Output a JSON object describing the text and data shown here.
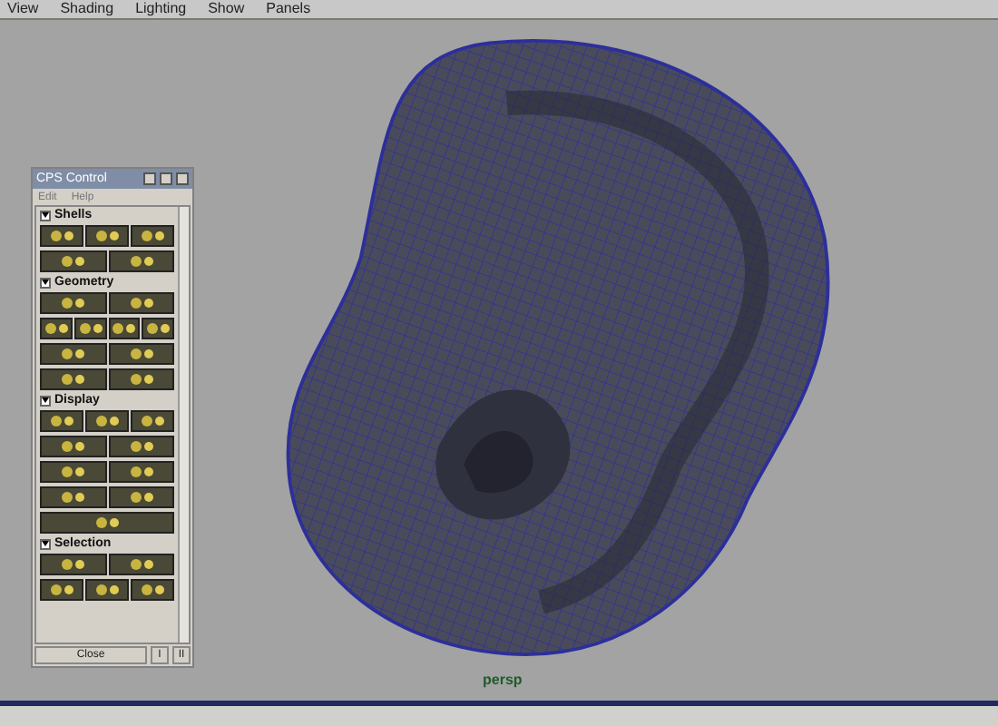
{
  "menu_bar": {
    "items": [
      "View",
      "Shading",
      "Lighting",
      "Show",
      "Panels"
    ]
  },
  "cps_panel": {
    "title": "CPS Control",
    "menus": [
      "Edit",
      "Help"
    ],
    "sections": [
      {
        "title": "Shells",
        "expanded": true
      },
      {
        "title": "Geometry",
        "expanded": true
      },
      {
        "title": "Display",
        "expanded": true
      },
      {
        "title": "Selection",
        "expanded": true
      }
    ],
    "buttons": [
      "Close",
      "I",
      "II"
    ]
  },
  "viewport": {
    "camera_label": "persp"
  }
}
